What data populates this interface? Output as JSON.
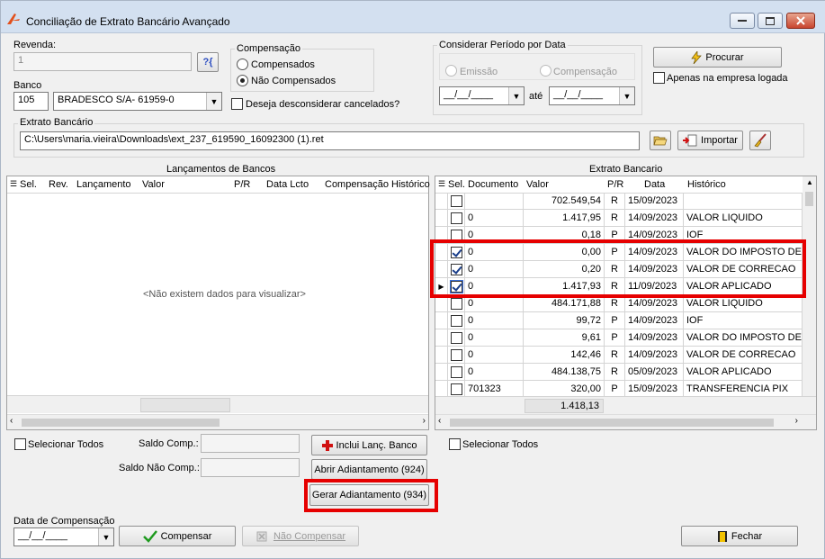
{
  "window": {
    "title": "Conciliação de Extrato Bancário Avançado"
  },
  "revenda": {
    "label": "Revenda:",
    "value": "1"
  },
  "banco": {
    "label": "Banco",
    "code": "105",
    "name": "BRADESCO S/A- 61959-0"
  },
  "compensacao_group": {
    "label": "Compensação",
    "opt1": "Compensados",
    "opt2": "Não Compensados",
    "selected": "Não Compensados"
  },
  "desconsiderar_label": "Deseja desconsiderar cancelados?",
  "periodo": {
    "label": "Considerar Período por Data",
    "opt1": "Emissão",
    "opt2": "Compensação",
    "date_from": "__/__/____",
    "ate": "até",
    "date_to": "__/__/____"
  },
  "procurar_label": "Procurar",
  "empresa_label": "Apenas na empresa logada",
  "extrato": {
    "label": "Extrato Bancário",
    "path": "C:\\Users\\maria.vieira\\Downloads\\ext_237_619590_16092300 (1).ret",
    "importar_label": "Importar"
  },
  "lanc": {
    "title": "Lançamentos de Bancos",
    "columns": [
      "Sel.",
      "Rev.",
      "Lançamento",
      "Valor",
      "P/R",
      "Data Lcto",
      "Compensação",
      "Histórico"
    ],
    "empty": "<Não existem dados para visualizar>"
  },
  "extrato_grid": {
    "title": "Extrato Bancario",
    "columns": [
      "Sel.",
      "Documento",
      "Valor",
      "P/R",
      "Data",
      "Histórico"
    ],
    "rows": [
      {
        "sel": false,
        "doc": "",
        "valor": "702.549,54",
        "pr": "R",
        "data": "15/09/2023",
        "hist": ""
      },
      {
        "sel": false,
        "doc": "0",
        "valor": "1.417,95",
        "pr": "R",
        "data": "14/09/2023",
        "hist": "VALOR LIQUIDO"
      },
      {
        "sel": false,
        "doc": "0",
        "valor": "0,18",
        "pr": "P",
        "data": "14/09/2023",
        "hist": "IOF"
      },
      {
        "sel": true,
        "doc": "0",
        "valor": "0,00",
        "pr": "P",
        "data": "14/09/2023",
        "hist": "VALOR DO IMPOSTO DE R"
      },
      {
        "sel": true,
        "doc": "0",
        "valor": "0,20",
        "pr": "R",
        "data": "14/09/2023",
        "hist": "VALOR DE CORRECAO"
      },
      {
        "sel": true,
        "doc": "0",
        "valor": "1.417,93",
        "pr": "R",
        "data": "11/09/2023",
        "hist": "VALOR APLICADO"
      },
      {
        "sel": false,
        "doc": "0",
        "valor": "484.171,88",
        "pr": "R",
        "data": "14/09/2023",
        "hist": "VALOR LIQUIDO"
      },
      {
        "sel": false,
        "doc": "0",
        "valor": "99,72",
        "pr": "P",
        "data": "14/09/2023",
        "hist": "IOF"
      },
      {
        "sel": false,
        "doc": "0",
        "valor": "9,61",
        "pr": "P",
        "data": "14/09/2023",
        "hist": "VALOR DO IMPOSTO DE R"
      },
      {
        "sel": false,
        "doc": "0",
        "valor": "142,46",
        "pr": "R",
        "data": "14/09/2023",
        "hist": "VALOR DE CORRECAO"
      },
      {
        "sel": false,
        "doc": "0",
        "valor": "484.138,75",
        "pr": "R",
        "data": "05/09/2023",
        "hist": "VALOR APLICADO"
      },
      {
        "sel": false,
        "doc": "701323",
        "valor": "320,00",
        "pr": "P",
        "data": "15/09/2023",
        "hist": "TRANSFERENCIA PIX"
      }
    ],
    "total": "1.418,13"
  },
  "bottom": {
    "sel_todos_left": "Selecionar Todos",
    "saldo_comp": "Saldo Comp.:",
    "saldo_nao_comp": "Saldo Não Comp.:",
    "inclui": "Inclui Lanç. Banco",
    "abrir": "Abrir Adiantamento (924)",
    "gerar": "Gerar Adiantamento (934)",
    "sel_todos_right": "Selecionar Todos",
    "data_comp_label": "Data de Compensação",
    "data_comp_value": "__/__/____",
    "compensar": "Compensar",
    "nao_compensar": "Não Compensar",
    "fechar": "Fechar"
  }
}
